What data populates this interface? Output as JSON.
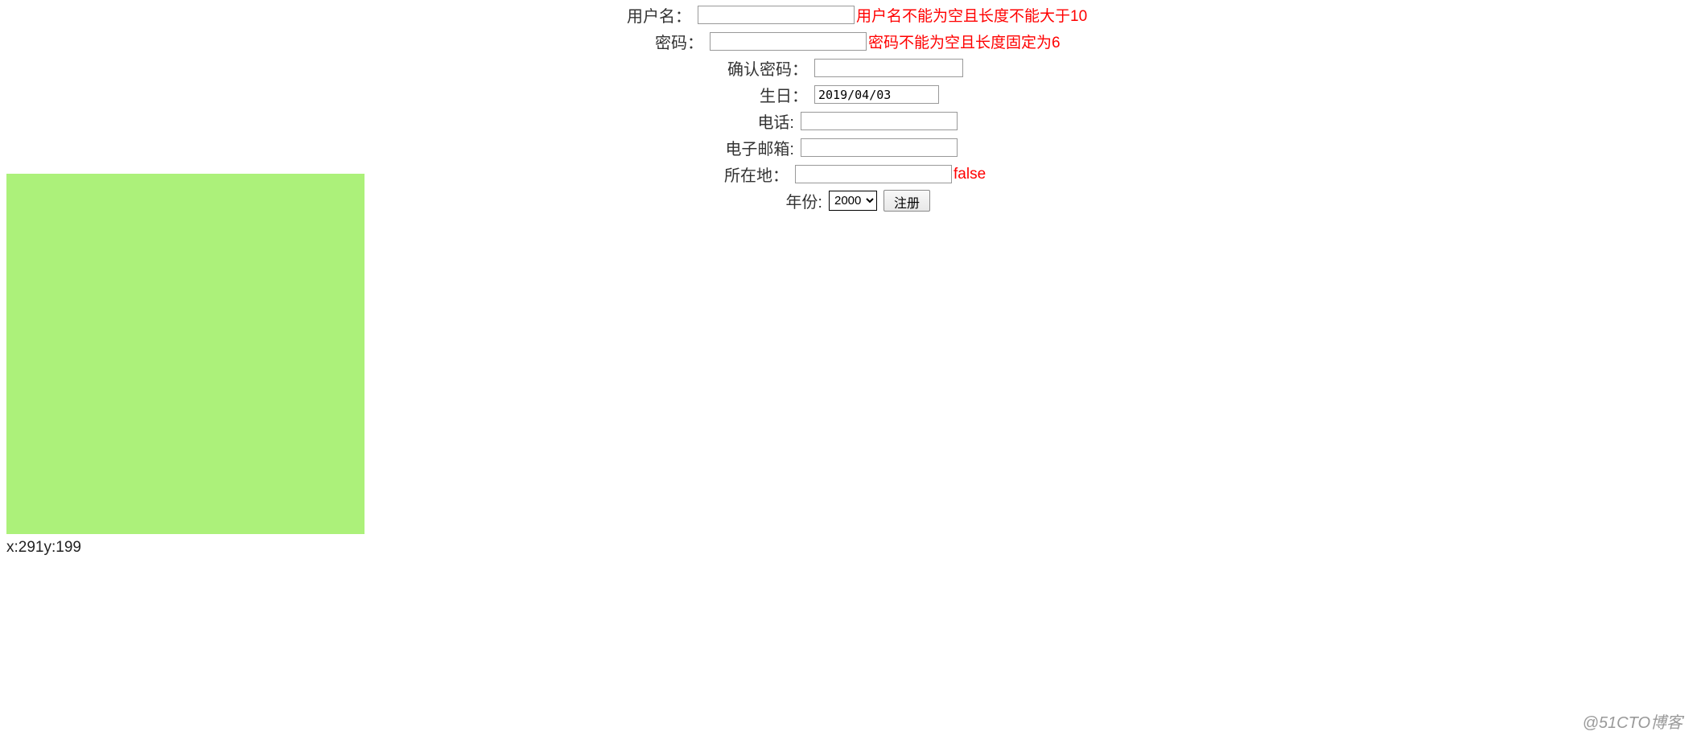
{
  "form": {
    "username": {
      "label": "用户名：",
      "value": "",
      "error": "用户名不能为空且长度不能大于10"
    },
    "password": {
      "label": "密码：",
      "value": "",
      "error": "密码不能为空且长度固定为6"
    },
    "confirm_password": {
      "label": "确认密码：",
      "value": ""
    },
    "birthday": {
      "label": "生日：",
      "value": "2019/04/03"
    },
    "phone": {
      "label": "电话:",
      "value": ""
    },
    "email": {
      "label": "电子邮箱:",
      "value": ""
    },
    "location": {
      "label": "所在地：",
      "value": "",
      "error": "false"
    },
    "year": {
      "label": "年份:",
      "selected": "2000"
    },
    "submit_label": "注册"
  },
  "coords": "x:291y:199",
  "watermark": "@51CTO博客",
  "colors": {
    "box_bg": "#acf17a",
    "error": "#ff0000"
  }
}
